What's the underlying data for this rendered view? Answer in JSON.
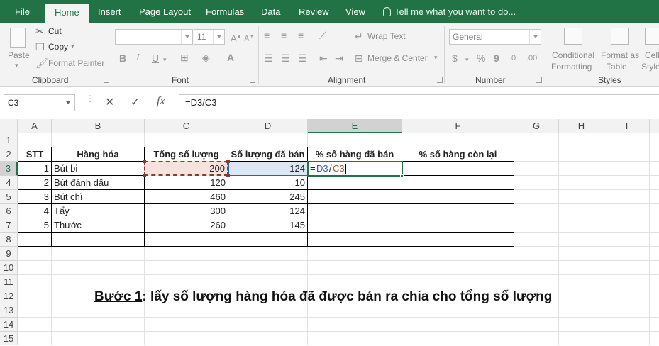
{
  "tabs": [
    "File",
    "Home",
    "Insert",
    "Page Layout",
    "Formulas",
    "Data",
    "Review",
    "View"
  ],
  "tell_me": "Tell me what you want to do...",
  "ribbon": {
    "paste": "Paste",
    "cut": "Cut",
    "copy": "Copy",
    "format_painter": "Format Painter",
    "clipboard": "Clipboard",
    "font_size": "11",
    "font_group": "Font",
    "bold": "B",
    "italic": "I",
    "underline": "U",
    "wrap_text": "Wrap Text",
    "merge_center": "Merge & Center",
    "alignment": "Alignment",
    "number_format": "General",
    "number_group": "Number",
    "percent": "%",
    "comma": "9",
    "conditional_formatting": [
      "Conditional",
      "Formatting"
    ],
    "format_as_table": [
      "Format as",
      "Table"
    ],
    "cell_styles": [
      "Cell",
      "Styles"
    ],
    "styles_group": "Styles"
  },
  "formula_bar": {
    "name_box": "C3",
    "cancel": "✕",
    "enter": "✓",
    "fx": "fx",
    "formula": "=D3/C3"
  },
  "columns": [
    "A",
    "B",
    "C",
    "D",
    "E",
    "F",
    "G",
    "H",
    "I"
  ],
  "rows": [
    "1",
    "2",
    "3",
    "4",
    "5",
    "6",
    "7",
    "8",
    "9",
    "10",
    "11",
    "12",
    "13",
    "14",
    "15"
  ],
  "table": {
    "headers": [
      "STT",
      "Hàng hóa",
      "Tổng số lượng",
      "Số lượng đã bán",
      "% số hàng đã bán",
      "% số hàng còn lại"
    ],
    "rows": [
      {
        "stt": "1",
        "name": "Bút bi",
        "total": "200",
        "sold": "124"
      },
      {
        "stt": "2",
        "name": "Bút đánh dấu",
        "total": "120",
        "sold": "10"
      },
      {
        "stt": "3",
        "name": "Bút chì",
        "total": "460",
        "sold": "245"
      },
      {
        "stt": "4",
        "name": "Tẩy",
        "total": "300",
        "sold": "124"
      },
      {
        "stt": "5",
        "name": "Thước",
        "total": "260",
        "sold": "145"
      }
    ],
    "editing_cell": {
      "eq": "=",
      "ref1": "D3",
      "slash": "/",
      "ref2": "C3"
    }
  },
  "caption": {
    "lead": "Bước 1",
    "rest": ": lấy số lượng hàng hóa đã được bán ra chia cho tổng số lượng"
  },
  "colors": {
    "brand": "#217346",
    "ref_d3": "#2e5fa8",
    "ref_c3": "#b04a39"
  }
}
